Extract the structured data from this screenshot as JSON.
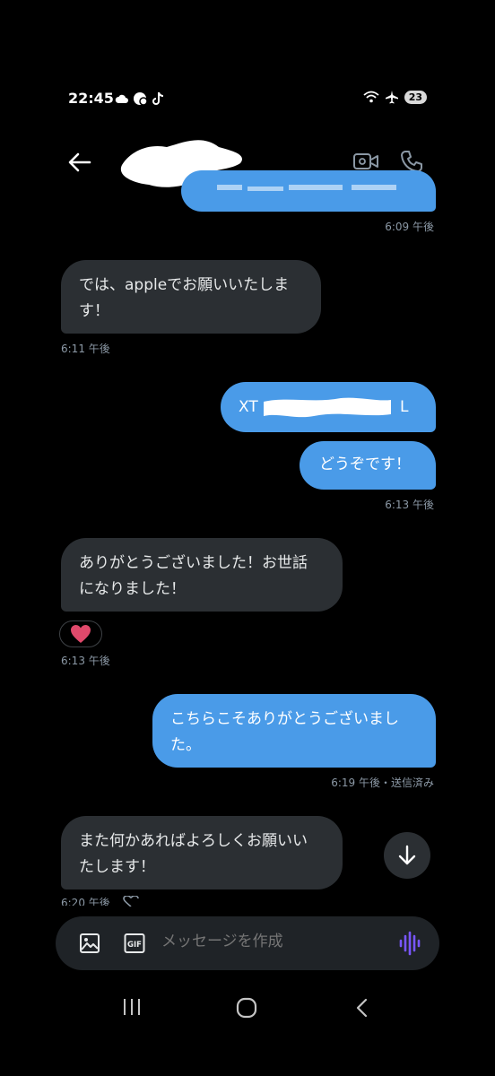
{
  "status_bar": {
    "time": "22:45",
    "battery_badge": "23",
    "icons_left": [
      "cloud-icon",
      "chat-icon",
      "tiktok-icon"
    ],
    "icons_right": [
      "wifi-icon",
      "airplane-icon"
    ]
  },
  "header": {
    "back_icon": "arrow-left-icon",
    "video_icon": "video-call-icon",
    "call_icon": "phone-icon"
  },
  "messages": [
    {
      "id": "m1",
      "direction": "out",
      "time": "6:09 午後"
    },
    {
      "id": "m2",
      "direction": "in",
      "lines": [
        "では、appleでお願いいたしま",
        "す！"
      ],
      "time": "6:11 午後"
    },
    {
      "id": "m3",
      "direction": "out",
      "text_prefix": "XT",
      "text_suffix": "L"
    },
    {
      "id": "m4",
      "direction": "out",
      "text": "どうぞです！",
      "time": "6:13 午後"
    },
    {
      "id": "m5",
      "direction": "in",
      "lines": [
        "ありがとうございました！お世話",
        "になりました！"
      ],
      "reaction": "heart",
      "time": "6:13 午後"
    },
    {
      "id": "m6",
      "direction": "out",
      "lines": [
        "こちらこそありがとうございまし",
        "た。"
      ],
      "time": "6:19 午後・送信済み"
    },
    {
      "id": "m7",
      "direction": "in",
      "lines": [
        "また何かあればよろしくお願いい",
        "たします！"
      ],
      "time": "6:20 午後"
    }
  ],
  "composer": {
    "placeholder": "メッセージを作成",
    "gif_label": "GIF"
  },
  "colors": {
    "outgoing_bubble": "#4a9be8",
    "incoming_bubble": "#2b2f33",
    "background": "#000000",
    "voice_accent": "#7856ff"
  }
}
